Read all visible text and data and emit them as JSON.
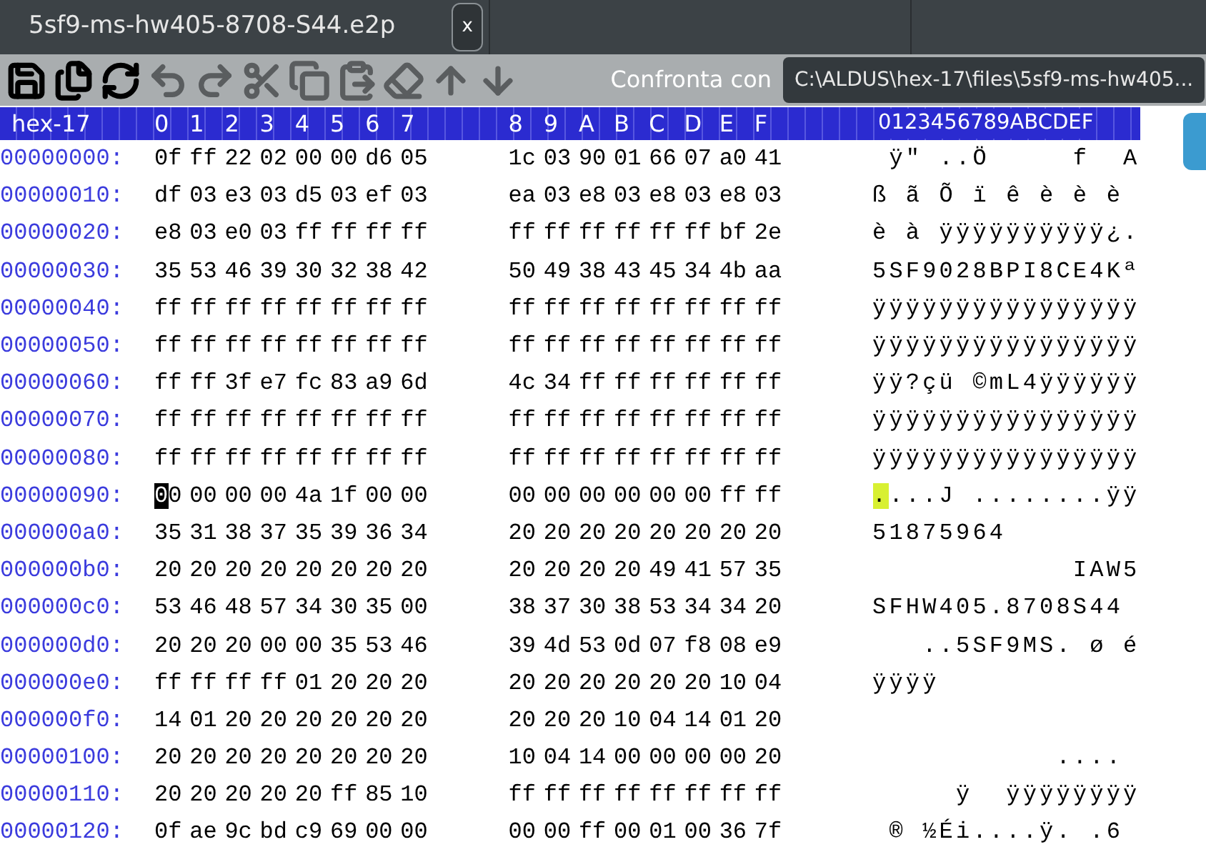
{
  "tab": {
    "title": "5sf9-ms-hw405-8708-S44.e2p",
    "close": "x",
    "selected": true
  },
  "toolbar": [
    {
      "kind": "save",
      "disabled": false
    },
    {
      "kind": "save-as",
      "disabled": false
    },
    {
      "kind": "reload",
      "disabled": false
    },
    {
      "kind": "undo",
      "disabled": true
    },
    {
      "kind": "redo",
      "disabled": true
    },
    {
      "kind": "cut",
      "disabled": true
    },
    {
      "kind": "copy",
      "disabled": true
    },
    {
      "kind": "paste",
      "disabled": true
    },
    {
      "kind": "erase",
      "disabled": true
    },
    {
      "kind": "up",
      "disabled": true
    },
    {
      "kind": "down",
      "disabled": true
    }
  ],
  "compare": {
    "label": "Confronta con",
    "value": "C:\\ALDUS\\hex-17\\files\\5sf9-ms-hw405..."
  },
  "header": {
    "name": "hex-17",
    "columns": [
      "0",
      "1",
      "2",
      "3",
      "4",
      "5",
      "6",
      "7",
      "8",
      "9",
      "A",
      "B",
      "C",
      "D",
      "E",
      "F"
    ],
    "ascii": "0123456789ABCDEF"
  },
  "rows": [
    {
      "address": "00000000:",
      "bytes": [
        "0f",
        "ff",
        "22",
        "02",
        "00",
        "00",
        "d6",
        "05",
        "1c",
        "03",
        "90",
        "01",
        "66",
        "07",
        "a0",
        "41"
      ],
      "ascii": " ÿ\" ..Ö     f  A",
      "cursor": false
    },
    {
      "address": "00000010:",
      "bytes": [
        "df",
        "03",
        "e3",
        "03",
        "d5",
        "03",
        "ef",
        "03",
        "ea",
        "03",
        "e8",
        "03",
        "e8",
        "03",
        "e8",
        "03"
      ],
      "ascii": "ß ã Õ ï ê è è è ",
      "cursor": false
    },
    {
      "address": "00000020:",
      "bytes": [
        "e8",
        "03",
        "e0",
        "03",
        "ff",
        "ff",
        "ff",
        "ff",
        "ff",
        "ff",
        "ff",
        "ff",
        "ff",
        "ff",
        "bf",
        "2e"
      ],
      "ascii": "è à ÿÿÿÿÿÿÿÿÿÿ¿.",
      "cursor": false
    },
    {
      "address": "00000030:",
      "bytes": [
        "35",
        "53",
        "46",
        "39",
        "30",
        "32",
        "38",
        "42",
        "50",
        "49",
        "38",
        "43",
        "45",
        "34",
        "4b",
        "aa"
      ],
      "ascii": "5SF9028BPI8CE4Kª",
      "cursor": false
    },
    {
      "address": "00000040:",
      "bytes": [
        "ff",
        "ff",
        "ff",
        "ff",
        "ff",
        "ff",
        "ff",
        "ff",
        "ff",
        "ff",
        "ff",
        "ff",
        "ff",
        "ff",
        "ff",
        "ff"
      ],
      "ascii": "ÿÿÿÿÿÿÿÿÿÿÿÿÿÿÿÿ",
      "cursor": false
    },
    {
      "address": "00000050:",
      "bytes": [
        "ff",
        "ff",
        "ff",
        "ff",
        "ff",
        "ff",
        "ff",
        "ff",
        "ff",
        "ff",
        "ff",
        "ff",
        "ff",
        "ff",
        "ff",
        "ff"
      ],
      "ascii": "ÿÿÿÿÿÿÿÿÿÿÿÿÿÿÿÿ",
      "cursor": false
    },
    {
      "address": "00000060:",
      "bytes": [
        "ff",
        "ff",
        "3f",
        "e7",
        "fc",
        "83",
        "a9",
        "6d",
        "4c",
        "34",
        "ff",
        "ff",
        "ff",
        "ff",
        "ff",
        "ff"
      ],
      "ascii": "ÿÿ?çü ©mL4ÿÿÿÿÿÿ",
      "cursor": false
    },
    {
      "address": "00000070:",
      "bytes": [
        "ff",
        "ff",
        "ff",
        "ff",
        "ff",
        "ff",
        "ff",
        "ff",
        "ff",
        "ff",
        "ff",
        "ff",
        "ff",
        "ff",
        "ff",
        "ff"
      ],
      "ascii": "ÿÿÿÿÿÿÿÿÿÿÿÿÿÿÿÿ",
      "cursor": false
    },
    {
      "address": "00000080:",
      "bytes": [
        "ff",
        "ff",
        "ff",
        "ff",
        "ff",
        "ff",
        "ff",
        "ff",
        "ff",
        "ff",
        "ff",
        "ff",
        "ff",
        "ff",
        "ff",
        "ff"
      ],
      "ascii": "ÿÿÿÿÿÿÿÿÿÿÿÿÿÿÿÿ",
      "cursor": false
    },
    {
      "address": "00000090:",
      "bytes": [
        "00",
        "00",
        "00",
        "00",
        "4a",
        "1f",
        "00",
        "00",
        "00",
        "00",
        "00",
        "00",
        "00",
        "00",
        "ff",
        "ff"
      ],
      "ascii": "....J ........ÿÿ",
      "cursor": true
    },
    {
      "address": "000000a0:",
      "bytes": [
        "35",
        "31",
        "38",
        "37",
        "35",
        "39",
        "36",
        "34",
        "20",
        "20",
        "20",
        "20",
        "20",
        "20",
        "20",
        "20"
      ],
      "ascii": "51875964",
      "cursor": false
    },
    {
      "address": "000000b0:",
      "bytes": [
        "20",
        "20",
        "20",
        "20",
        "20",
        "20",
        "20",
        "20",
        "20",
        "20",
        "20",
        "20",
        "49",
        "41",
        "57",
        "35"
      ],
      "ascii": "            IAW5",
      "cursor": false
    },
    {
      "address": "000000c0:",
      "bytes": [
        "53",
        "46",
        "48",
        "57",
        "34",
        "30",
        "35",
        "00",
        "38",
        "37",
        "30",
        "38",
        "53",
        "34",
        "34",
        "20"
      ],
      "ascii": "SFHW405.8708S44",
      "cursor": false
    },
    {
      "address": "000000d0:",
      "bytes": [
        "20",
        "20",
        "20",
        "00",
        "00",
        "35",
        "53",
        "46",
        "39",
        "4d",
        "53",
        "0d",
        "07",
        "f8",
        "08",
        "e9"
      ],
      "ascii": "   ..5SF9MS. ø é",
      "cursor": false
    },
    {
      "address": "000000e0:",
      "bytes": [
        "ff",
        "ff",
        "ff",
        "ff",
        "01",
        "20",
        "20",
        "20",
        "20",
        "20",
        "20",
        "20",
        "20",
        "20",
        "10",
        "04"
      ],
      "ascii": "ÿÿÿÿ",
      "cursor": false
    },
    {
      "address": "000000f0:",
      "bytes": [
        "14",
        "01",
        "20",
        "20",
        "20",
        "20",
        "20",
        "20",
        "20",
        "20",
        "20",
        "10",
        "04",
        "14",
        "01",
        "20"
      ],
      "ascii": "",
      "cursor": false
    },
    {
      "address": "00000100:",
      "bytes": [
        "20",
        "20",
        "20",
        "20",
        "20",
        "20",
        "20",
        "20",
        "10",
        "04",
        "14",
        "00",
        "00",
        "00",
        "00",
        "20"
      ],
      "ascii": "           .... ",
      "cursor": false
    },
    {
      "address": "00000110:",
      "bytes": [
        "20",
        "20",
        "20",
        "20",
        "20",
        "ff",
        "85",
        "10",
        "ff",
        "ff",
        "ff",
        "ff",
        "ff",
        "ff",
        "ff",
        "ff"
      ],
      "ascii": "     ÿ  ÿÿÿÿÿÿÿÿ",
      "cursor": false
    },
    {
      "address": "00000120:",
      "bytes": [
        "0f",
        "ae",
        "9c",
        "bd",
        "c9",
        "69",
        "00",
        "00",
        "00",
        "00",
        "ff",
        "00",
        "01",
        "00",
        "36",
        "7f"
      ],
      "ascii": " ® ½Éi....ÿ. .6 ",
      "cursor": false
    }
  ]
}
